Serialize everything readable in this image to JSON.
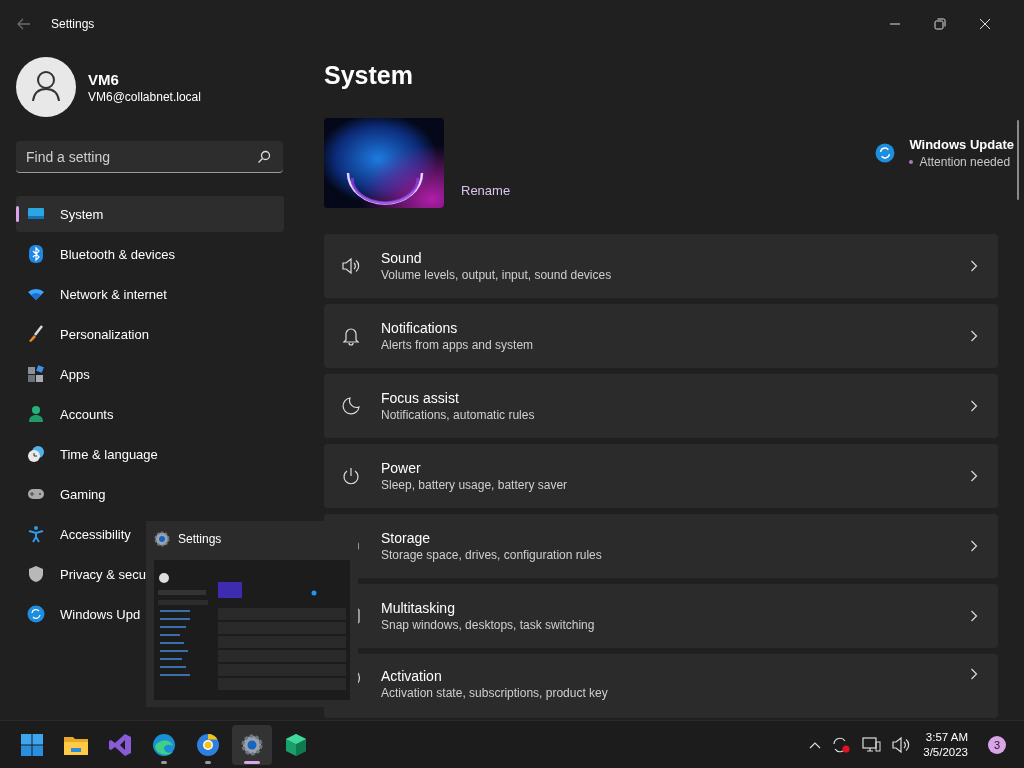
{
  "window": {
    "title": "Settings"
  },
  "user": {
    "name": "VM6",
    "email": "VM6@collabnet.local"
  },
  "search": {
    "placeholder": "Find a setting"
  },
  "nav": [
    {
      "kind": "system",
      "label": "System",
      "selected": true
    },
    {
      "kind": "bluetooth",
      "label": "Bluetooth & devices",
      "selected": false
    },
    {
      "kind": "network",
      "label": "Network & internet",
      "selected": false
    },
    {
      "kind": "brush",
      "label": "Personalization",
      "selected": false
    },
    {
      "kind": "apps",
      "label": "Apps",
      "selected": false
    },
    {
      "kind": "accounts",
      "label": "Accounts",
      "selected": false
    },
    {
      "kind": "time",
      "label": "Time & language",
      "selected": false
    },
    {
      "kind": "gaming",
      "label": "Gaming",
      "selected": false
    },
    {
      "kind": "accessibility",
      "label": "Accessibility",
      "selected": false
    },
    {
      "kind": "privacy",
      "label": "Privacy & secu",
      "selected": false
    },
    {
      "kind": "update",
      "label": "Windows Upd",
      "selected": false
    }
  ],
  "page": {
    "title": "System",
    "rename": "Rename",
    "update": {
      "title": "Windows Update",
      "status": "Attention needed"
    }
  },
  "cards": [
    {
      "kind": "sound",
      "title": "Sound",
      "description": "Volume levels, output, input, sound devices"
    },
    {
      "kind": "notifications",
      "title": "Notifications",
      "description": "Alerts from apps and system"
    },
    {
      "kind": "focus",
      "title": "Focus assist",
      "description": "Notifications, automatic rules"
    },
    {
      "kind": "power",
      "title": "Power",
      "description": "Sleep, battery usage, battery saver"
    },
    {
      "kind": "storage",
      "title": "Storage",
      "description": "Storage space, drives, configuration rules"
    },
    {
      "kind": "multitasking",
      "title": "Multitasking",
      "description": "Snap windows, desktops, task switching"
    },
    {
      "kind": "activation",
      "title": "Activation",
      "description": "Activation state, subscriptions, product key"
    }
  ],
  "preview": {
    "title": "Settings"
  },
  "taskbar": {
    "apps": [
      {
        "kind": "start",
        "running": false,
        "selected": false
      },
      {
        "kind": "folder",
        "running": false,
        "selected": false
      },
      {
        "kind": "studio",
        "running": false,
        "selected": false
      },
      {
        "kind": "edge",
        "running": true,
        "selected": false
      },
      {
        "kind": "browser",
        "running": true,
        "selected": false
      },
      {
        "kind": "gear",
        "running": true,
        "selected": true
      },
      {
        "kind": "cube",
        "running": false,
        "selected": false
      }
    ],
    "time": "3:57 AM",
    "date": "3/5/2023",
    "badge": "3"
  }
}
